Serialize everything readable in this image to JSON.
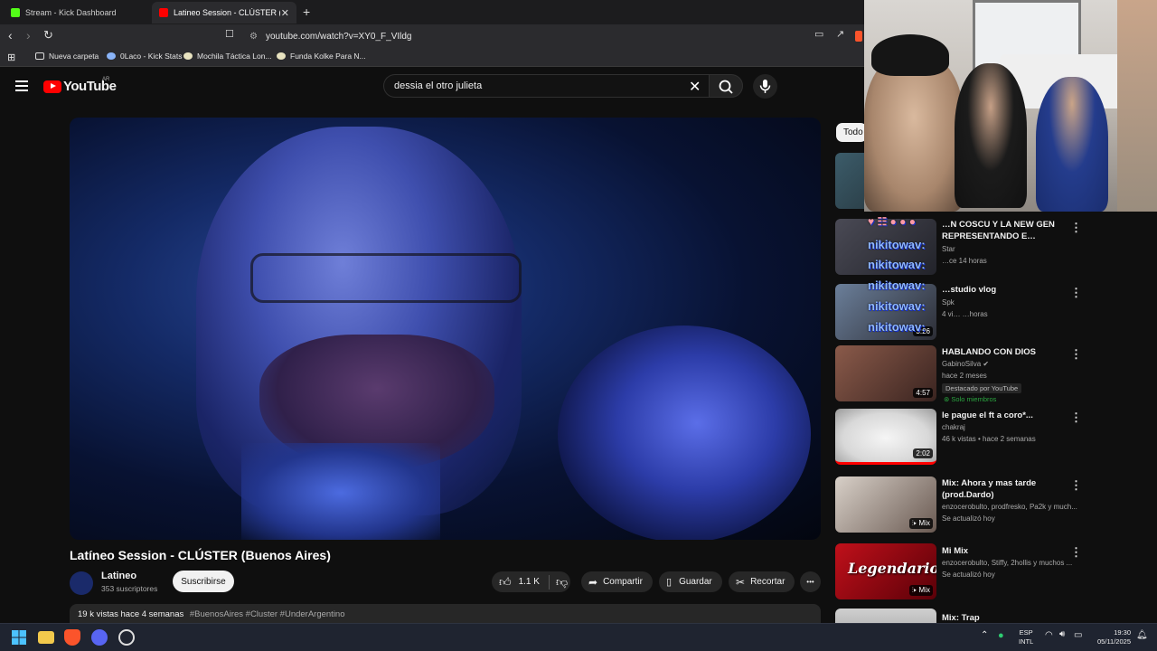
{
  "browser": {
    "tabs": [
      {
        "label": "Stream - Kick Dashboard",
        "active": false
      },
      {
        "label": "Latineo Session - CLÚSTER (Buen",
        "active": true
      }
    ],
    "new_tab": "+",
    "url": "youtube.com/watch?v=XY0_F_VIldg",
    "bookmarks": [
      "Nueva carpeta",
      "0Laco - Kick Stats",
      "Mochila Táctica Lon...",
      "Funda Kolke Para N..."
    ]
  },
  "youtube": {
    "logo": "YouTube",
    "country": "AR",
    "search_value": "dessia el otro julieta",
    "video": {
      "title": "Latíneo Session - CLÚSTER (Buenos Aires)",
      "channel": "Latineo",
      "subscribers": "353 suscriptores",
      "subscribe_label": "Suscribirse",
      "likes": "1.1 K",
      "share_label": "Compartir",
      "save_label": "Guardar",
      "clip_label": "Recortar",
      "more_label": "•••",
      "views_time": "19 k vistas  hace 4 semanas",
      "tags": "#BuenosAires #Cluster #UnderArgentino"
    },
    "chip_all": "Todo",
    "recommendations": [
      {
        "title": "…N COSCU Y LA NEW GEN REPRESENTANDO E…",
        "channel": "Star",
        "meta": "…ce 14 horas",
        "duration": ""
      },
      {
        "title": "…studio vlog",
        "channel": "Spk",
        "meta": "4 vi… …horas",
        "duration": "3:26"
      },
      {
        "title": "HABLANDO CON DIOS",
        "channel": "GabinoSilva",
        "meta": "hace 2 meses",
        "badge": "Destacado por YouTube",
        "members": "Solo miembros",
        "duration": "4:57"
      },
      {
        "title": "le pague el ft a coro*...",
        "channel": "chakraj",
        "meta": "46 k vistas • hace 2 semanas",
        "duration": "2:02"
      },
      {
        "title": "Mix: Ahora y mas tarde (prod.Dardo)",
        "channel": "enzocerobulto, prodfresko, Pa2k y much...",
        "meta": "Se actualizó hoy",
        "duration": "Mix"
      },
      {
        "title": "Mi Mix",
        "channel": "enzocerobulto, Stiffy, 2hollis y muchos ...",
        "meta": "Se actualizó hoy",
        "duration": "Mix",
        "thumb_text": "Legendario"
      },
      {
        "title": "Mix: Trap",
        "channel": "",
        "meta": "",
        "duration": ""
      }
    ]
  },
  "overlay": {
    "chat_lines": [
      "nikitowav:",
      "nikitowav:",
      "nikitowav:",
      "nikitowav:",
      "nikitowav:"
    ]
  },
  "taskbar": {
    "lang_top": "ESP",
    "lang_bottom": "INTL",
    "time": "19:30",
    "date": "05/11/2025"
  },
  "colors": {
    "yt_red": "#ff0000",
    "bg": "#0f0f0f",
    "pill": "#272727",
    "members_green": "#2ba640"
  }
}
